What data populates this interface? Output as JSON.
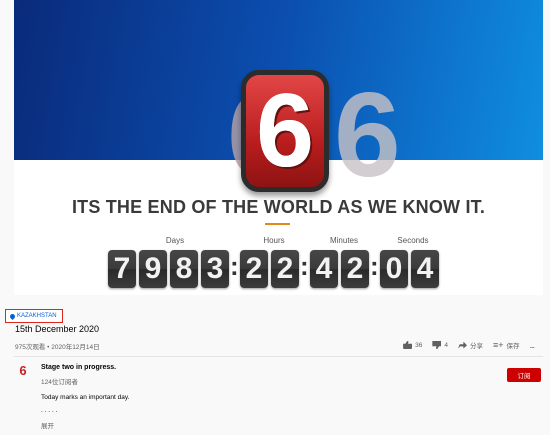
{
  "video": {
    "headline": "ITS THE END OF THE WORLD AS WE KNOW IT.",
    "big_numeral": "6",
    "ghost_numeral": "6",
    "countdown": {
      "labels": {
        "days": "Days",
        "hours": "Hours",
        "minutes": "Minutes",
        "seconds": "Seconds"
      },
      "days": [
        "7",
        "9",
        "8",
        "3"
      ],
      "hours": [
        "2",
        "2"
      ],
      "minutes": [
        "4",
        "2"
      ],
      "seconds": [
        "0",
        "4"
      ],
      "separator": ":"
    },
    "colors": {
      "banner_start": "#0a2a7a",
      "banner_end": "#0f8ee0",
      "accent_red": "#c41e1e",
      "rule_orange": "#e08a1e"
    }
  },
  "info": {
    "location": "KAZAKHSTAN",
    "title": "15th December 2020",
    "meta": "975次观看 • 2020年12月14日"
  },
  "actions": {
    "likes": "36",
    "dislikes": "4",
    "share": "分享",
    "save": "保存",
    "more": "..."
  },
  "channel": {
    "logo": "6",
    "name": "Stage two in progress.",
    "subscribers": "124位订阅者",
    "subscribe_label": "订阅"
  },
  "description": {
    "line1": "Today marks an important day.",
    "line2": ". . . . .",
    "show_more": "展开"
  },
  "icons": [
    "location-pin-icon",
    "thumbs-up-icon",
    "thumbs-down-icon",
    "share-icon",
    "save-icon",
    "more-icon"
  ]
}
